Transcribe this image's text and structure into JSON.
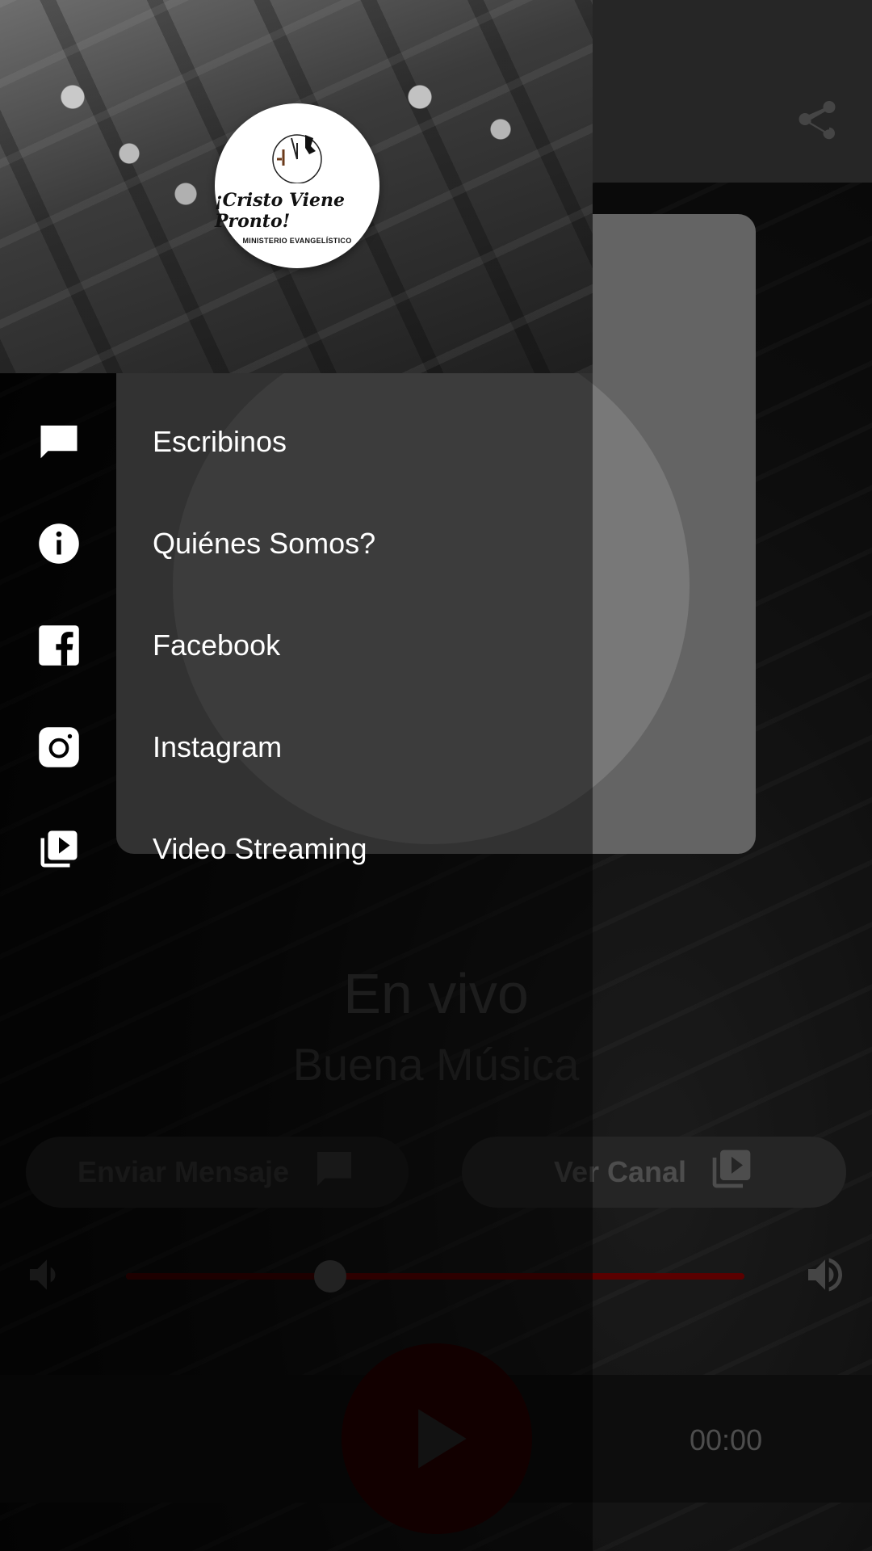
{
  "app": {
    "live_title": "En vivo",
    "live_subtitle": "Buena Música",
    "send_message_label": "Enviar Mensaje",
    "view_channel_label": "Ver Canal",
    "time": "00:00",
    "volume_level": 0.33,
    "accent_color": "#8b0000"
  },
  "drawer": {
    "logo": {
      "title": "¡Cristo Viene Pronto!",
      "subtitle": "MINISTERIO EVANGELÍSTICO"
    },
    "items": [
      {
        "label": "Escribinos",
        "icon": "message-icon"
      },
      {
        "label": "Quiénes Somos?",
        "icon": "info-icon"
      },
      {
        "label": "Facebook",
        "icon": "facebook-icon"
      },
      {
        "label": "Instagram",
        "icon": "instagram-icon"
      },
      {
        "label": "Video Streaming",
        "icon": "video-library-icon"
      }
    ]
  }
}
